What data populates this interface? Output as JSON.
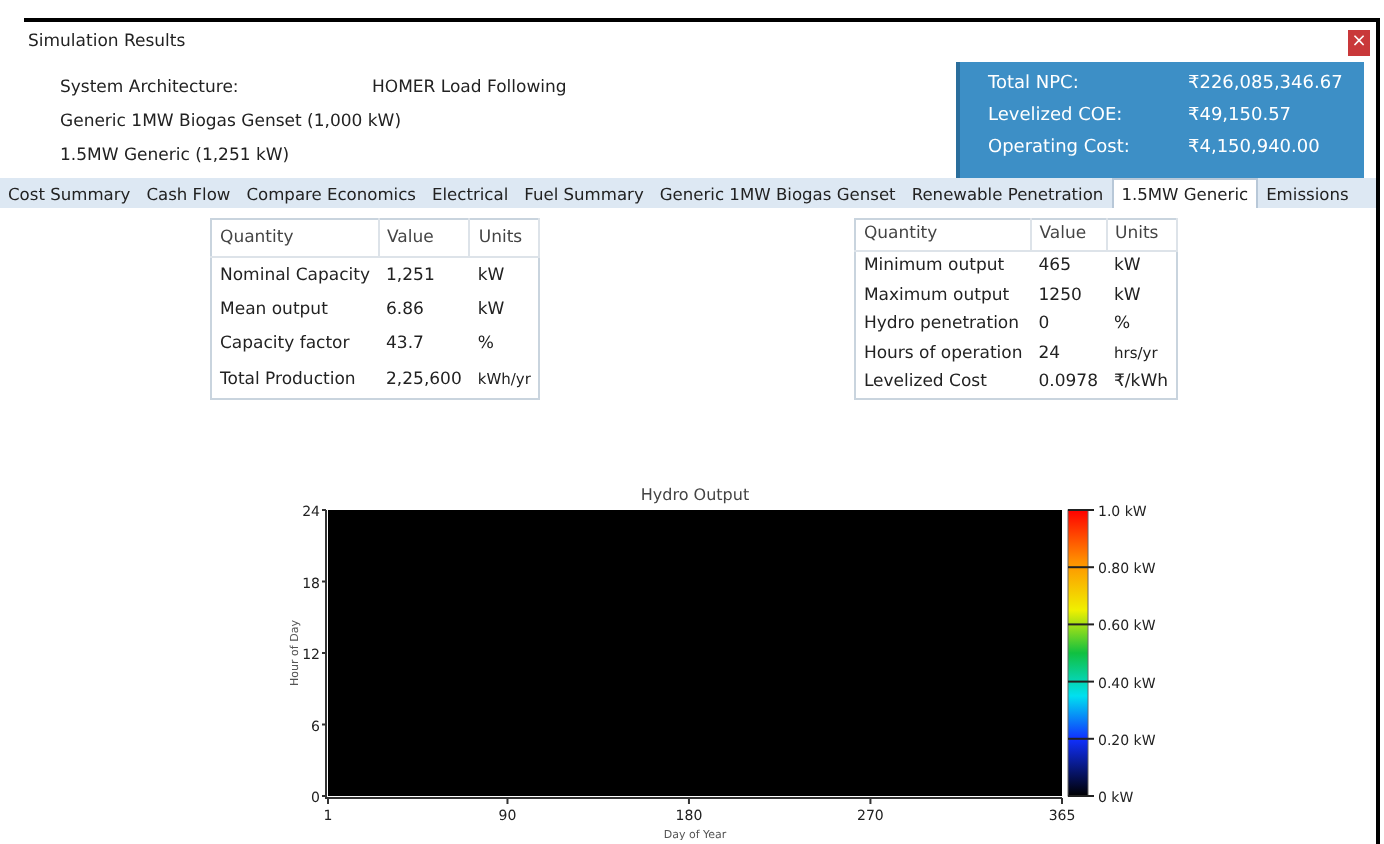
{
  "window": {
    "title": "Simulation Results",
    "close": "×"
  },
  "architecture": {
    "label": "System Architecture:",
    "dispatch": "HOMER Load Following",
    "components": [
      "Generic 1MW Biogas Genset (1,000 kW)",
      "1.5MW Generic (1,251 kW)"
    ]
  },
  "summary": [
    {
      "label": "Total NPC:",
      "value": "₹226,085,346.67"
    },
    {
      "label": "Levelized COE:",
      "value": "₹49,150.57"
    },
    {
      "label": "Operating Cost:",
      "value": "₹4,150,940.00"
    }
  ],
  "tabs": [
    {
      "label": "Cost Summary",
      "selected": false
    },
    {
      "label": "Cash Flow",
      "selected": false
    },
    {
      "label": "Compare Economics",
      "selected": false
    },
    {
      "label": "Electrical",
      "selected": false
    },
    {
      "label": "Fuel Summary",
      "selected": false
    },
    {
      "label": "Generic 1MW Biogas Genset",
      "selected": false
    },
    {
      "label": "Renewable Penetration",
      "selected": false
    },
    {
      "label": "1.5MW Generic",
      "selected": true
    },
    {
      "label": "Emissions",
      "selected": false
    }
  ],
  "tables": [
    {
      "columns": [
        "Quantity",
        "Value",
        "Units"
      ],
      "rows": [
        [
          "Nominal Capacity",
          "1,251",
          "kW"
        ],
        [
          "Mean output",
          "6.86",
          "kW"
        ],
        [
          "Capacity factor",
          "43.7",
          "%"
        ],
        [
          "Total Production",
          "2,25,600",
          "kWh/yr"
        ]
      ]
    },
    {
      "columns": [
        "Quantity",
        "Value",
        "Units"
      ],
      "rows": [
        [
          "Minimum output",
          "465",
          "kW"
        ],
        [
          "Maximum output",
          "1250",
          "kW"
        ],
        [
          "Hydro penetration",
          "0",
          "%"
        ],
        [
          "Hours of operation",
          "24",
          "hrs/yr"
        ],
        [
          "Levelized Cost",
          "0.0978",
          "₹/kWh"
        ]
      ]
    }
  ],
  "plot": {
    "title": "Hydro Output",
    "xlabel": "Day of Year",
    "ylabel": "Hour of Day",
    "xticks": [
      "1",
      "90",
      "180",
      "270",
      "365"
    ],
    "yticks": [
      "24",
      "18",
      "12",
      "6",
      "0"
    ],
    "scale_labels": [
      "1.0 kW",
      "0.80 kW",
      "0.60 kW",
      "0.40 kW",
      "0.20 kW",
      "0 kW"
    ]
  }
}
